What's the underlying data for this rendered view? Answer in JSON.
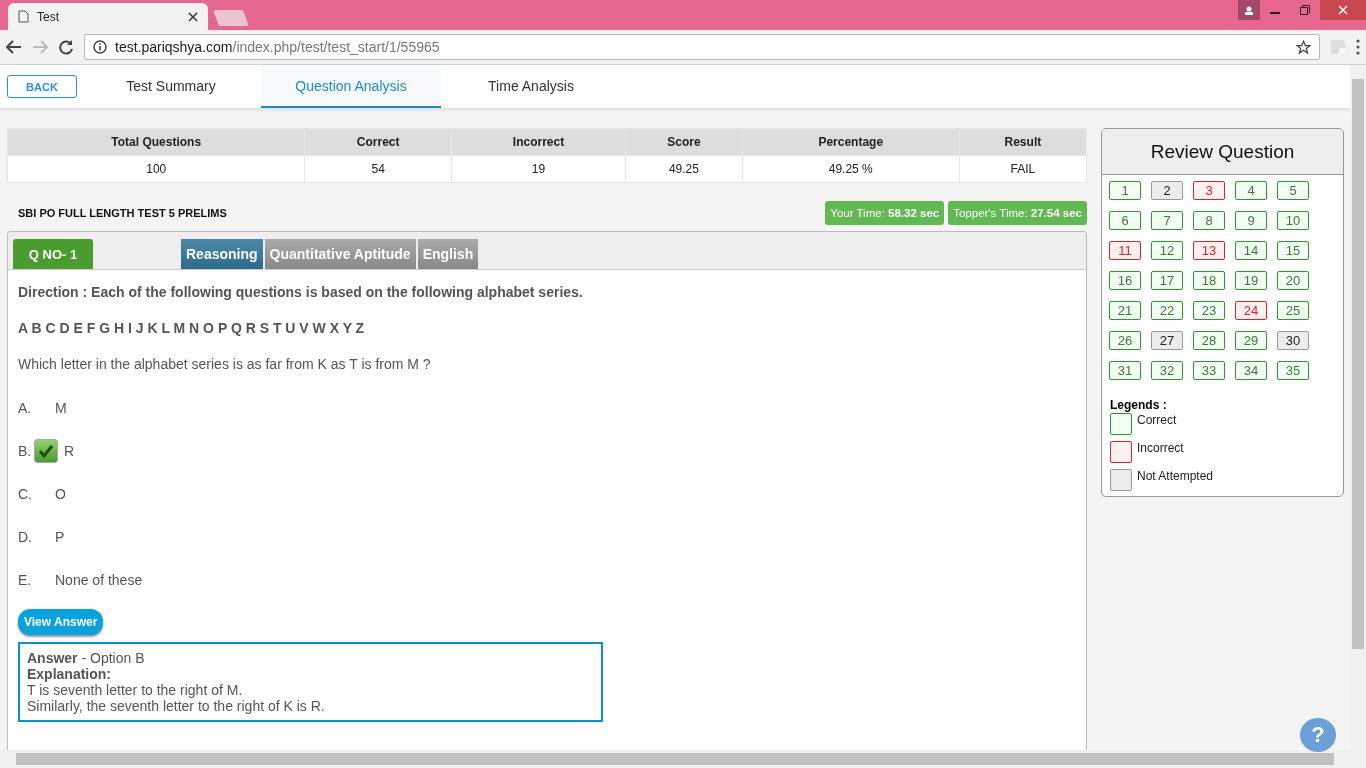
{
  "browser": {
    "tab_title": "Test",
    "url_host": "test.pariqshya.com",
    "url_path": "/index.php/test/test_start/1/55965"
  },
  "nav": {
    "back": "BACK",
    "tabs": [
      {
        "label": "Test Summary",
        "selected": false
      },
      {
        "label": "Question Analysis",
        "selected": true
      },
      {
        "label": "Time Analysis",
        "selected": false
      }
    ]
  },
  "summary": {
    "columns": [
      "Total Questions",
      "Correct",
      "Incorrect",
      "Score",
      "Percentage",
      "Result"
    ],
    "values": [
      "100",
      "54",
      "19",
      "49.25",
      "49.25 %",
      "FAIL"
    ]
  },
  "test_title": "SBI PO FULL LENGTH TEST 5 PRELIMS",
  "times": [
    {
      "label": "Your Time:",
      "value": "58.32 sec"
    },
    {
      "label": "Topper's Time:",
      "value": "27.54 sec"
    }
  ],
  "question": {
    "number": "Q NO- 1",
    "sections": [
      {
        "label": "Reasoning",
        "selected": true
      },
      {
        "label": "Quantitative Aptitude",
        "selected": false
      },
      {
        "label": "English",
        "selected": false
      }
    ],
    "direction": "Direction : Each of the following questions is based on the following alphabet series.",
    "series": "A B C D E F G H I J K L M N O P Q R S T U V W X Y Z",
    "text": "Which letter in the alphabet series is as far from K as T is from M ?",
    "options": [
      {
        "letter": "A.",
        "text": "M",
        "checked": false
      },
      {
        "letter": "B.",
        "text": "R",
        "checked": true
      },
      {
        "letter": "C.",
        "text": "O",
        "checked": false
      },
      {
        "letter": "D.",
        "text": "P",
        "checked": false
      },
      {
        "letter": "E.",
        "text": "None of these",
        "checked": false
      }
    ],
    "view_answer": "View Answer",
    "answer": "**Answer** - Option B",
    "explanation_label": "Explanation:",
    "explanation": [
      "T is seventh letter to the right of M.",
      "Similarly, the seventh letter to the right of K is R."
    ]
  },
  "review": {
    "title": "Review Question",
    "questions": [
      {
        "label": "1",
        "kind": "correct"
      },
      {
        "label": "2",
        "kind": "not_attempted"
      },
      {
        "label": "3",
        "kind": "incorrect"
      },
      {
        "label": "4",
        "kind": "correct"
      },
      {
        "label": "5",
        "kind": "correct"
      },
      {
        "label": "6",
        "kind": "correct"
      },
      {
        "label": "7",
        "kind": "correct"
      },
      {
        "label": "8",
        "kind": "correct"
      },
      {
        "label": "9",
        "kind": "correct"
      },
      {
        "label": "10",
        "kind": "correct"
      },
      {
        "label": "11",
        "kind": "incorrect"
      },
      {
        "label": "12",
        "kind": "correct"
      },
      {
        "label": "13",
        "kind": "incorrect"
      },
      {
        "label": "14",
        "kind": "correct"
      },
      {
        "label": "15",
        "kind": "correct"
      },
      {
        "label": "16",
        "kind": "correct"
      },
      {
        "label": "17",
        "kind": "correct"
      },
      {
        "label": "18",
        "kind": "correct"
      },
      {
        "label": "19",
        "kind": "correct"
      },
      {
        "label": "20",
        "kind": "correct"
      },
      {
        "label": "21",
        "kind": "correct"
      },
      {
        "label": "22",
        "kind": "correct"
      },
      {
        "label": "23",
        "kind": "correct"
      },
      {
        "label": "24",
        "kind": "incorrect"
      },
      {
        "label": "25",
        "kind": "correct"
      },
      {
        "label": "26",
        "kind": "correct"
      },
      {
        "label": "27",
        "kind": "not_attempted"
      },
      {
        "label": "28",
        "kind": "correct"
      },
      {
        "label": "29",
        "kind": "correct"
      },
      {
        "label": "30",
        "kind": "not_attempted"
      },
      {
        "label": "31",
        "kind": "correct"
      },
      {
        "label": "32",
        "kind": "correct"
      },
      {
        "label": "33",
        "kind": "correct"
      },
      {
        "label": "34",
        "kind": "correct"
      },
      {
        "label": "35",
        "kind": "correct"
      }
    ],
    "legends_title": "Legends :",
    "legends": [
      {
        "label": "Correct",
        "kind": "correct"
      },
      {
        "label": "Incorrect",
        "kind": "incorrect"
      },
      {
        "label": "Not Attempted",
        "kind": "not_attempted"
      }
    ]
  },
  "help": "?"
}
